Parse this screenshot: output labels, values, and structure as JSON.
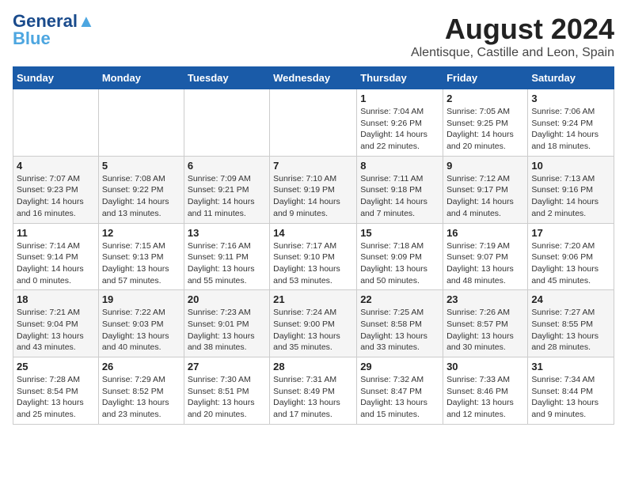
{
  "header": {
    "logo_line1": "General",
    "logo_line2": "Blue",
    "month": "August 2024",
    "location": "Alentisque, Castille and Leon, Spain"
  },
  "weekdays": [
    "Sunday",
    "Monday",
    "Tuesday",
    "Wednesday",
    "Thursday",
    "Friday",
    "Saturday"
  ],
  "weeks": [
    [
      {
        "day": "",
        "info": ""
      },
      {
        "day": "",
        "info": ""
      },
      {
        "day": "",
        "info": ""
      },
      {
        "day": "",
        "info": ""
      },
      {
        "day": "1",
        "info": "Sunrise: 7:04 AM\nSunset: 9:26 PM\nDaylight: 14 hours\nand 22 minutes."
      },
      {
        "day": "2",
        "info": "Sunrise: 7:05 AM\nSunset: 9:25 PM\nDaylight: 14 hours\nand 20 minutes."
      },
      {
        "day": "3",
        "info": "Sunrise: 7:06 AM\nSunset: 9:24 PM\nDaylight: 14 hours\nand 18 minutes."
      }
    ],
    [
      {
        "day": "4",
        "info": "Sunrise: 7:07 AM\nSunset: 9:23 PM\nDaylight: 14 hours\nand 16 minutes."
      },
      {
        "day": "5",
        "info": "Sunrise: 7:08 AM\nSunset: 9:22 PM\nDaylight: 14 hours\nand 13 minutes."
      },
      {
        "day": "6",
        "info": "Sunrise: 7:09 AM\nSunset: 9:21 PM\nDaylight: 14 hours\nand 11 minutes."
      },
      {
        "day": "7",
        "info": "Sunrise: 7:10 AM\nSunset: 9:19 PM\nDaylight: 14 hours\nand 9 minutes."
      },
      {
        "day": "8",
        "info": "Sunrise: 7:11 AM\nSunset: 9:18 PM\nDaylight: 14 hours\nand 7 minutes."
      },
      {
        "day": "9",
        "info": "Sunrise: 7:12 AM\nSunset: 9:17 PM\nDaylight: 14 hours\nand 4 minutes."
      },
      {
        "day": "10",
        "info": "Sunrise: 7:13 AM\nSunset: 9:16 PM\nDaylight: 14 hours\nand 2 minutes."
      }
    ],
    [
      {
        "day": "11",
        "info": "Sunrise: 7:14 AM\nSunset: 9:14 PM\nDaylight: 14 hours\nand 0 minutes."
      },
      {
        "day": "12",
        "info": "Sunrise: 7:15 AM\nSunset: 9:13 PM\nDaylight: 13 hours\nand 57 minutes."
      },
      {
        "day": "13",
        "info": "Sunrise: 7:16 AM\nSunset: 9:11 PM\nDaylight: 13 hours\nand 55 minutes."
      },
      {
        "day": "14",
        "info": "Sunrise: 7:17 AM\nSunset: 9:10 PM\nDaylight: 13 hours\nand 53 minutes."
      },
      {
        "day": "15",
        "info": "Sunrise: 7:18 AM\nSunset: 9:09 PM\nDaylight: 13 hours\nand 50 minutes."
      },
      {
        "day": "16",
        "info": "Sunrise: 7:19 AM\nSunset: 9:07 PM\nDaylight: 13 hours\nand 48 minutes."
      },
      {
        "day": "17",
        "info": "Sunrise: 7:20 AM\nSunset: 9:06 PM\nDaylight: 13 hours\nand 45 minutes."
      }
    ],
    [
      {
        "day": "18",
        "info": "Sunrise: 7:21 AM\nSunset: 9:04 PM\nDaylight: 13 hours\nand 43 minutes."
      },
      {
        "day": "19",
        "info": "Sunrise: 7:22 AM\nSunset: 9:03 PM\nDaylight: 13 hours\nand 40 minutes."
      },
      {
        "day": "20",
        "info": "Sunrise: 7:23 AM\nSunset: 9:01 PM\nDaylight: 13 hours\nand 38 minutes."
      },
      {
        "day": "21",
        "info": "Sunrise: 7:24 AM\nSunset: 9:00 PM\nDaylight: 13 hours\nand 35 minutes."
      },
      {
        "day": "22",
        "info": "Sunrise: 7:25 AM\nSunset: 8:58 PM\nDaylight: 13 hours\nand 33 minutes."
      },
      {
        "day": "23",
        "info": "Sunrise: 7:26 AM\nSunset: 8:57 PM\nDaylight: 13 hours\nand 30 minutes."
      },
      {
        "day": "24",
        "info": "Sunrise: 7:27 AM\nSunset: 8:55 PM\nDaylight: 13 hours\nand 28 minutes."
      }
    ],
    [
      {
        "day": "25",
        "info": "Sunrise: 7:28 AM\nSunset: 8:54 PM\nDaylight: 13 hours\nand 25 minutes."
      },
      {
        "day": "26",
        "info": "Sunrise: 7:29 AM\nSunset: 8:52 PM\nDaylight: 13 hours\nand 23 minutes."
      },
      {
        "day": "27",
        "info": "Sunrise: 7:30 AM\nSunset: 8:51 PM\nDaylight: 13 hours\nand 20 minutes."
      },
      {
        "day": "28",
        "info": "Sunrise: 7:31 AM\nSunset: 8:49 PM\nDaylight: 13 hours\nand 17 minutes."
      },
      {
        "day": "29",
        "info": "Sunrise: 7:32 AM\nSunset: 8:47 PM\nDaylight: 13 hours\nand 15 minutes."
      },
      {
        "day": "30",
        "info": "Sunrise: 7:33 AM\nSunset: 8:46 PM\nDaylight: 13 hours\nand 12 minutes."
      },
      {
        "day": "31",
        "info": "Sunrise: 7:34 AM\nSunset: 8:44 PM\nDaylight: 13 hours\nand 9 minutes."
      }
    ]
  ]
}
